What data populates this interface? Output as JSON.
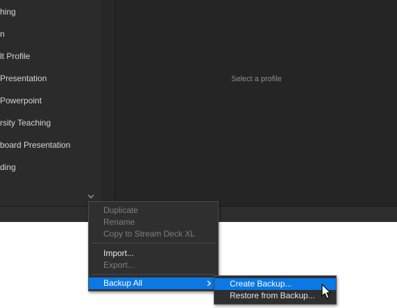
{
  "sidebar": {
    "profiles": [
      {
        "label": "hing"
      },
      {
        "label": "n"
      },
      {
        "label": "lt Profile"
      },
      {
        "label": " Presentation"
      },
      {
        "label": " Powerpoint"
      },
      {
        "label": "rsity Teaching"
      },
      {
        "label": "board Presentation"
      },
      {
        "label": "ding"
      }
    ],
    "scroll_icon": "chevron-down-icon"
  },
  "main": {
    "empty_hint": "Select a profile"
  },
  "context_menu": {
    "items": {
      "duplicate": "Duplicate",
      "rename": "Rename",
      "copy_to": "Copy to Stream Deck XL",
      "import": "Import...",
      "export": "Export...",
      "backup_all": "Backup All"
    },
    "submenu_icon": "chevron-right-icon"
  },
  "submenu": {
    "items": {
      "create_backup": "Create Backup...",
      "restore_backup": "Restore from Backup..."
    }
  },
  "colors": {
    "menu_highlight": "#0b78e3",
    "app_background": "#252525",
    "sidebar_background": "#2b2b2b",
    "disabled_text": "#7f7f7f"
  },
  "cursor_icon": "arrow-pointer-icon"
}
